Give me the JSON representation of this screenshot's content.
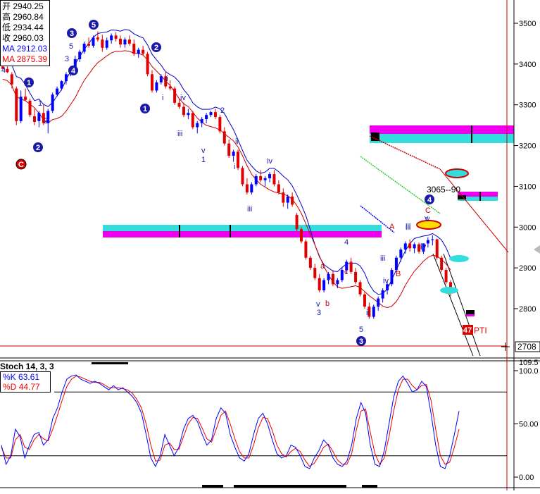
{
  "info_box": {
    "open_label": "开",
    "open": "2940.25",
    "high_label": "高",
    "high": "2960.84",
    "low_label": "低",
    "low": "2934.44",
    "close_label": "收",
    "close": "2960.03",
    "ma1_label": "MA",
    "ma1": "2912.03",
    "ma2_label": "MA",
    "ma2": "2875.39"
  },
  "colors": {
    "up_candle": "#0000ff",
    "down_candle": "#e00000",
    "ma_fast": "#0000cc",
    "ma_slow": "#cc0000",
    "zone_cyan": "#33dddd",
    "zone_magenta": "#ee00ee",
    "stoch_k": "#0000ff",
    "stoch_d": "#ee0000",
    "channel_line": "#000000",
    "green_line": "#33cc33"
  },
  "price_axis": {
    "ticks": [
      "3500",
      "3400",
      "3300",
      "3200",
      "3100",
      "3000",
      "2900",
      "2800"
    ],
    "current_label": "2708"
  },
  "stoch": {
    "title": "Stoch 14, 3, 3",
    "k_label": "%K",
    "k_value": "63.61",
    "d_label": "%D",
    "d_value": "44.77",
    "ticks": [
      "100.0",
      "50.00",
      "0.00"
    ],
    "top_tick": "109.5"
  },
  "annotations": {
    "wave_circles": [
      "1",
      "2",
      "3",
      "4",
      "5",
      "1",
      "2",
      "3",
      "4"
    ],
    "c_circle": "C",
    "level_text": "3065--90",
    "pti_value": "47",
    "pti_text": "PTI",
    "labels": [
      "4",
      "3",
      "5",
      "1",
      "2",
      "i",
      "ii",
      "iii",
      "iv",
      "v",
      "1",
      "2",
      "i",
      "ii",
      "iii",
      "iv",
      "iii",
      "iv",
      "v",
      "a",
      "b",
      "c",
      "4",
      "v",
      "3",
      "5",
      "ii",
      "iii",
      "iv",
      "A",
      "B",
      "C",
      "iii",
      "iv",
      "v"
    ]
  },
  "chart_data": {
    "type": "candlestick",
    "price_range": [
      2700,
      3560
    ],
    "price_ticks": [
      2800,
      2900,
      3000,
      3100,
      3200,
      3300,
      3400,
      3500
    ],
    "candles": [
      [
        3394,
        3410,
        3388,
        3388
      ],
      [
        3388,
        3395,
        3378,
        3380
      ],
      [
        3375,
        3380,
        3340,
        3350
      ],
      [
        3340,
        3345,
        3250,
        3260
      ],
      [
        3260,
        3335,
        3255,
        3320
      ],
      [
        3320,
        3340,
        3310,
        3312
      ],
      [
        3310,
        3315,
        3270,
        3275
      ],
      [
        3272,
        3290,
        3250,
        3258
      ],
      [
        3260,
        3285,
        3245,
        3280
      ],
      [
        3280,
        3300,
        3250,
        3255
      ],
      [
        3255,
        3290,
        3230,
        3285
      ],
      [
        3285,
        3330,
        3280,
        3325
      ],
      [
        3325,
        3345,
        3320,
        3340
      ],
      [
        3340,
        3360,
        3335,
        3358
      ],
      [
        3358,
        3380,
        3350,
        3375
      ],
      [
        3375,
        3395,
        3370,
        3390
      ],
      [
        3390,
        3420,
        3385,
        3412
      ],
      [
        3412,
        3435,
        3405,
        3430
      ],
      [
        3430,
        3455,
        3425,
        3450
      ],
      [
        3450,
        3465,
        3440,
        3445
      ],
      [
        3445,
        3470,
        3440,
        3465
      ],
      [
        3465,
        3480,
        3455,
        3460
      ],
      [
        3460,
        3472,
        3430,
        3440
      ],
      [
        3440,
        3465,
        3435,
        3458
      ],
      [
        3458,
        3475,
        3450,
        3470
      ],
      [
        3470,
        3478,
        3455,
        3462
      ],
      [
        3462,
        3470,
        3440,
        3448
      ],
      [
        3448,
        3465,
        3440,
        3460
      ],
      [
        3460,
        3470,
        3445,
        3450
      ],
      [
        3450,
        3460,
        3420,
        3425
      ],
      [
        3425,
        3440,
        3415,
        3435
      ],
      [
        3435,
        3445,
        3420,
        3425
      ],
      [
        3425,
        3430,
        3370,
        3375
      ],
      [
        3375,
        3385,
        3330,
        3335
      ],
      [
        3335,
        3360,
        3330,
        3355
      ],
      [
        3355,
        3375,
        3350,
        3370
      ],
      [
        3370,
        3380,
        3340,
        3345
      ],
      [
        3345,
        3360,
        3335,
        3340
      ],
      [
        3340,
        3345,
        3300,
        3305
      ],
      [
        3305,
        3315,
        3290,
        3295
      ],
      [
        3295,
        3305,
        3270,
        3275
      ],
      [
        3275,
        3290,
        3265,
        3280
      ],
      [
        3280,
        3285,
        3240,
        3245
      ],
      [
        3245,
        3260,
        3230,
        3255
      ],
      [
        3255,
        3270,
        3245,
        3265
      ],
      [
        3265,
        3280,
        3255,
        3275
      ],
      [
        3275,
        3285,
        3270,
        3282
      ],
      [
        3282,
        3290,
        3265,
        3270
      ],
      [
        3270,
        3275,
        3230,
        3235
      ],
      [
        3235,
        3245,
        3200,
        3205
      ],
      [
        3205,
        3215,
        3170,
        3175
      ],
      [
        3175,
        3190,
        3160,
        3185
      ],
      [
        3185,
        3190,
        3140,
        3145
      ],
      [
        3145,
        3150,
        3100,
        3105
      ],
      [
        3105,
        3120,
        3080,
        3085
      ],
      [
        3085,
        3110,
        3080,
        3105
      ],
      [
        3105,
        3130,
        3100,
        3125
      ],
      [
        3125,
        3140,
        3110,
        3115
      ],
      [
        3115,
        3125,
        3100,
        3120
      ],
      [
        3120,
        3135,
        3110,
        3130
      ],
      [
        3130,
        3140,
        3100,
        3105
      ],
      [
        3105,
        3115,
        3080,
        3085
      ],
      [
        3085,
        3095,
        3050,
        3060
      ],
      [
        3060,
        3080,
        3045,
        3075
      ],
      [
        3075,
        3085,
        3050,
        3055
      ],
      [
        3030,
        3035,
        2990,
        2995
      ],
      [
        2995,
        3000,
        2960,
        2965
      ],
      [
        2965,
        2970,
        2920,
        2925
      ],
      [
        2925,
        2930,
        2895,
        2900
      ],
      [
        2900,
        2910,
        2870,
        2875
      ],
      [
        2875,
        2885,
        2840,
        2845
      ],
      [
        2845,
        2875,
        2840,
        2870
      ],
      [
        2870,
        2890,
        2860,
        2885
      ],
      [
        2885,
        2895,
        2855,
        2860
      ],
      [
        2860,
        2875,
        2850,
        2870
      ],
      [
        2870,
        2900,
        2865,
        2895
      ],
      [
        2895,
        2920,
        2885,
        2915
      ],
      [
        2915,
        2925,
        2885,
        2890
      ],
      [
        2890,
        2900,
        2860,
        2865
      ],
      [
        2865,
        2870,
        2830,
        2835
      ],
      [
        2835,
        2840,
        2800,
        2805
      ],
      [
        2805,
        2815,
        2775,
        2780
      ],
      [
        2780,
        2810,
        2775,
        2805
      ],
      [
        2805,
        2830,
        2795,
        2825
      ],
      [
        2825,
        2850,
        2815,
        2845
      ],
      [
        2845,
        2865,
        2835,
        2860
      ],
      [
        2860,
        2900,
        2855,
        2895
      ],
      [
        2895,
        2930,
        2890,
        2925
      ],
      [
        2925,
        2950,
        2915,
        2945
      ],
      [
        2945,
        2965,
        2935,
        2960
      ],
      [
        2960,
        2970,
        2940,
        2948
      ],
      [
        2948,
        2962,
        2936,
        2958
      ],
      [
        2958,
        2962,
        2935,
        2940
      ],
      [
        2940,
        2960,
        2934,
        2960
      ],
      [
        2960,
        2975,
        2950,
        2968
      ],
      [
        2968,
        2980,
        2955,
        2970
      ],
      [
        2970,
        2972,
        2920,
        2925
      ],
      [
        2925,
        2930,
        2890,
        2895
      ],
      [
        2895,
        2900,
        2860,
        2865
      ],
      [
        2865,
        2870,
        2830,
        2838
      ]
    ],
    "series": [
      {
        "name": "%K",
        "values": [
          30,
          12,
          20,
          45,
          38,
          18,
          30,
          40,
          42,
          30,
          35,
          55,
          65,
          80,
          92,
          95,
          96,
          92,
          90,
          88,
          90,
          88,
          85,
          82,
          86,
          82,
          84,
          80,
          76,
          70,
          60,
          40,
          18,
          10,
          20,
          40,
          30,
          20,
          28,
          45,
          55,
          58,
          52,
          40,
          30,
          35,
          55,
          65,
          60,
          40,
          28,
          18,
          15,
          22,
          40,
          55,
          60,
          50,
          35,
          22,
          18,
          20,
          30,
          28,
          20,
          10,
          8,
          18,
          25,
          35,
          30,
          18,
          12,
          10,
          15,
          30,
          55,
          70,
          60,
          30,
          12,
          10,
          25,
          50,
          75,
          90,
          95,
          88,
          80,
          82,
          90,
          85,
          60,
          30,
          10,
          8,
          20,
          40,
          62
        ]
      },
      {
        "name": "%D",
        "values": [
          28,
          18,
          18,
          35,
          40,
          28,
          26,
          35,
          40,
          36,
          34,
          45,
          58,
          72,
          85,
          92,
          95,
          94,
          92,
          90,
          89,
          89,
          87,
          84,
          84,
          84,
          83,
          82,
          79,
          73,
          65,
          50,
          30,
          15,
          16,
          30,
          32,
          26,
          26,
          38,
          50,
          56,
          55,
          46,
          36,
          33,
          45,
          58,
          62,
          50,
          36,
          24,
          18,
          18,
          30,
          46,
          56,
          55,
          44,
          30,
          22,
          19,
          24,
          27,
          24,
          16,
          10,
          13,
          20,
          28,
          31,
          24,
          16,
          12,
          12,
          22,
          44,
          62,
          64,
          42,
          22,
          12,
          18,
          38,
          62,
          82,
          92,
          92,
          86,
          82,
          86,
          87,
          72,
          45,
          20,
          12,
          14,
          28,
          45
        ]
      }
    ]
  }
}
